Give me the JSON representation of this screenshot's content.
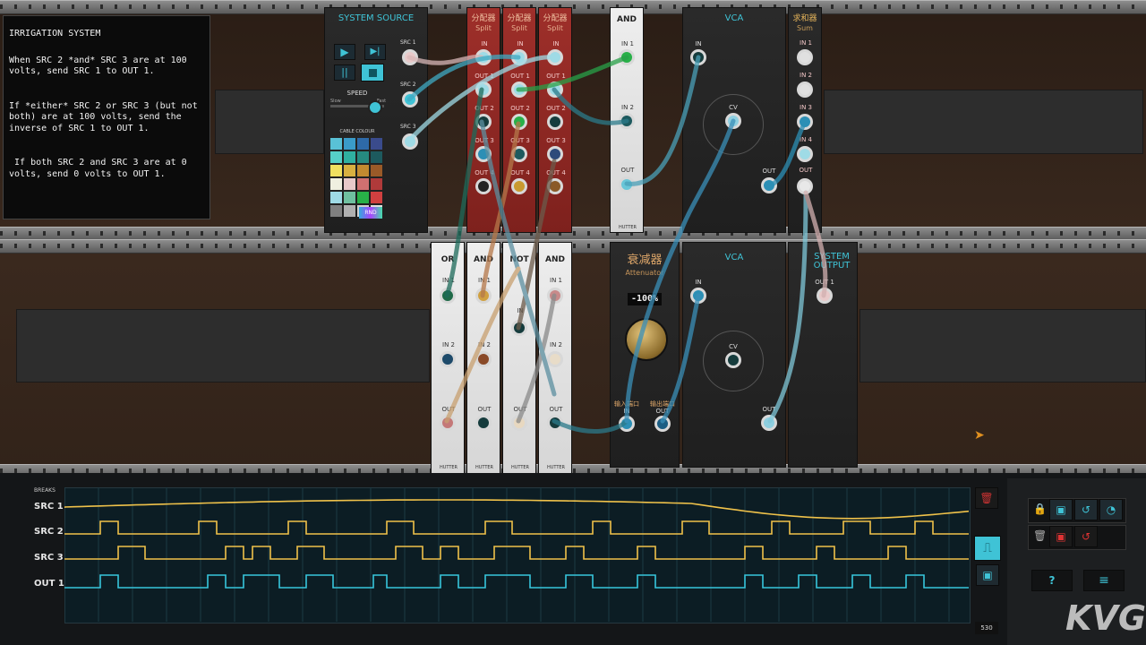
{
  "note": {
    "title": "IRRIGATION SYSTEM",
    "lines": [
      "When SRC 2 *and* SRC 3 are at 100 volts, send SRC 1 to OUT 1.",
      "If *either* SRC 2 or SRC 3 (but not both) are at 100 volts, send the inverse of SRC 1 to OUT 1.",
      " If both SRC 2 and SRC 3 are at 0 volts, send 0 volts to OUT 1."
    ]
  },
  "system_source": {
    "title": "SYSTEM SOURCE",
    "speed_label": "SPEED",
    "slow_label": "Slow",
    "fast_label": "Fast",
    "cable_colour_label": "CABLE COLOUR",
    "rnd_label": "RND",
    "outputs": [
      "SRC 1",
      "SRC 2",
      "SRC 3"
    ]
  },
  "split_modules": [
    {
      "cn": "分配器",
      "en": "Split"
    },
    {
      "cn": "分配器",
      "en": "Split"
    },
    {
      "cn": "分配器",
      "en": "Split"
    }
  ],
  "split_labels": {
    "in": "IN",
    "outs": [
      "OUT 1",
      "OUT 2",
      "OUT 3",
      "OUT 4"
    ]
  },
  "and_top": {
    "title": "AND",
    "in1": "IN 1",
    "in2": "IN 2",
    "out": "OUT",
    "brand": "HUTTER"
  },
  "vca_top": {
    "title": "VCA",
    "in": "IN",
    "cv": "CV",
    "out": "OUT"
  },
  "sum": {
    "cn": "求和器",
    "en": "Sum",
    "ins": [
      "IN 1",
      "IN 2",
      "IN 3",
      "IN 4"
    ],
    "out": "OUT"
  },
  "logic_modules": [
    {
      "title": "OR",
      "in1": "IN 1",
      "in2": "IN 2",
      "out": "OUT",
      "brand": "HUTTER"
    },
    {
      "title": "AND",
      "in1": "IN 1",
      "in2": "IN 2",
      "out": "OUT",
      "brand": "HUTTER"
    },
    {
      "title": "NOT",
      "in1": "IN",
      "in2": "",
      "out": "OUT",
      "brand": "HUTTER"
    },
    {
      "title": "AND",
      "in1": "IN 1",
      "in2": "IN 2",
      "out": "OUT",
      "brand": "HUTTER"
    }
  ],
  "attenuator": {
    "cn": "衰减器",
    "en": "Attenuator",
    "value": "-100%",
    "in_cn": "输入端口",
    "in": "IN",
    "out_cn": "输出端口",
    "out": "OUT"
  },
  "vca_bottom": {
    "title": "VCA",
    "in": "IN",
    "cv": "CV",
    "out": "OUT"
  },
  "system_output": {
    "title": "SYSTEM OUTPUT",
    "out1": "OUT 1"
  },
  "scope": {
    "breaks_label": "BREAKS",
    "traces": [
      "SRC 1",
      "SRC 2",
      "SRC 3",
      "OUT 1"
    ],
    "counter": "530"
  },
  "colors": {
    "accent": "#3fc3d6",
    "trace_yellow": "#f0c24a",
    "trace_cyan": "#37c6dc",
    "split_red": "#9e2f2a"
  },
  "watermark": "KVG"
}
